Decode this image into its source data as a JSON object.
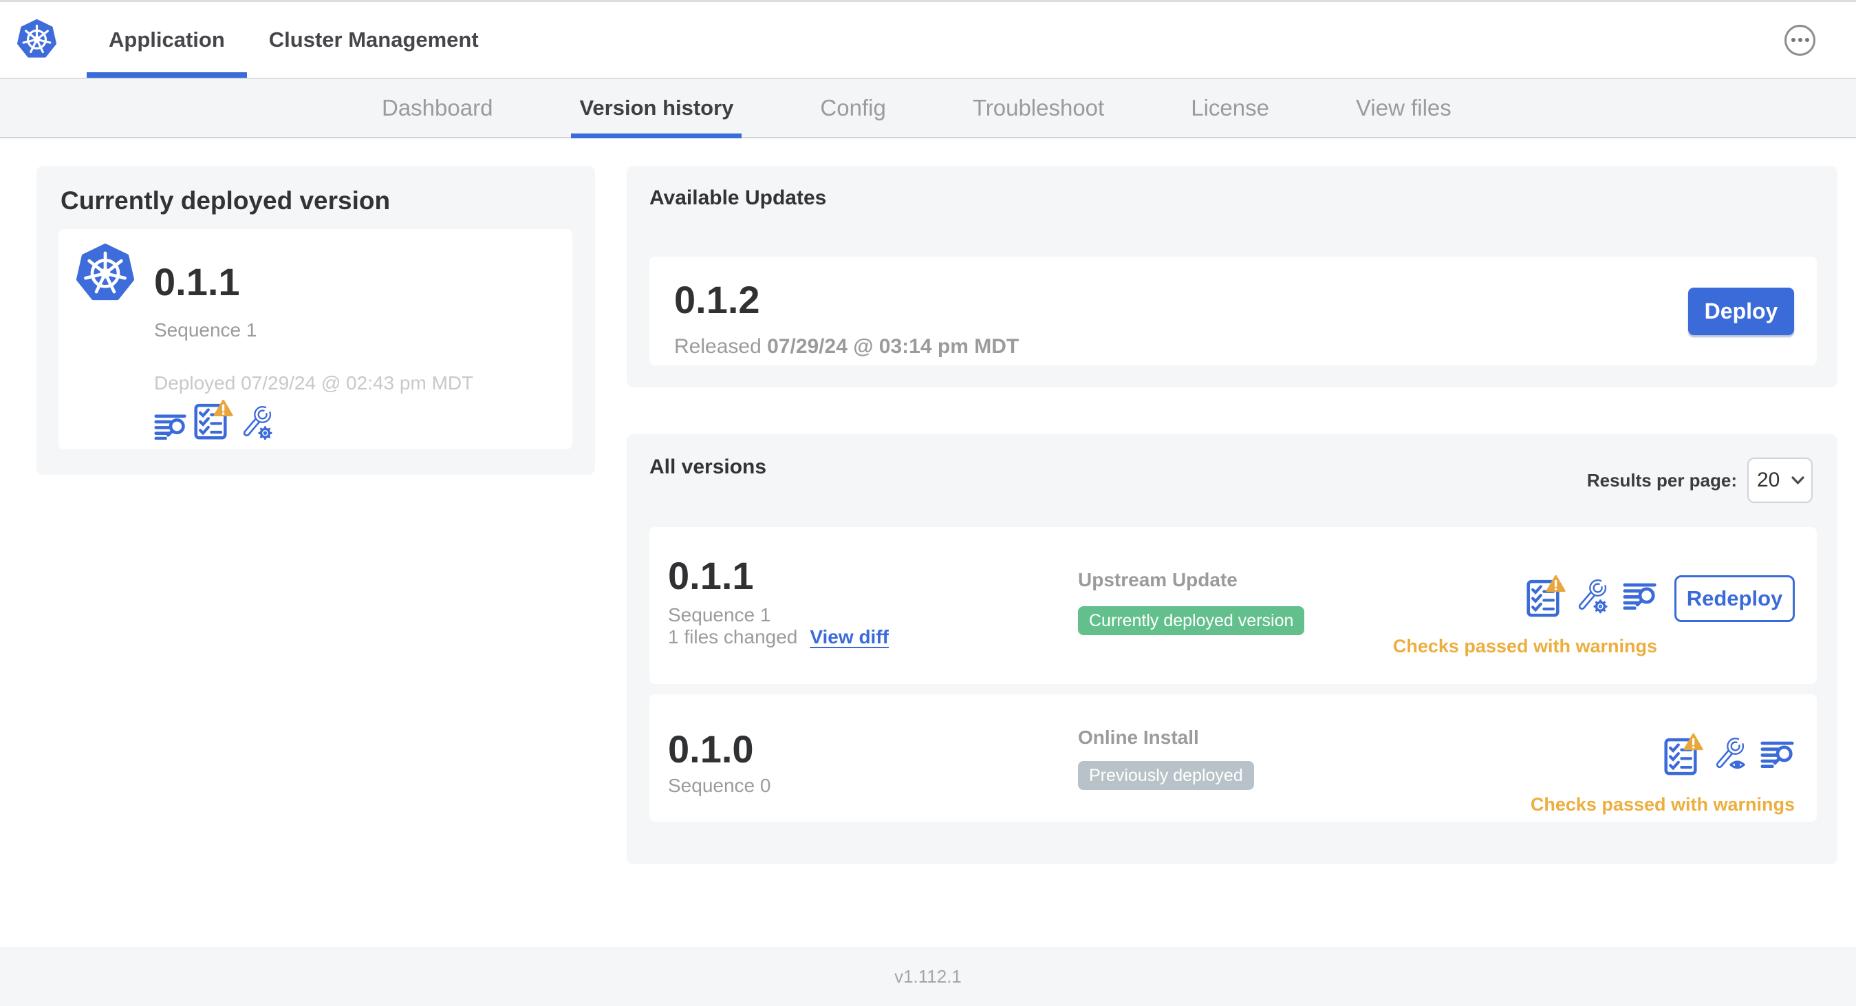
{
  "header": {
    "tabs": [
      {
        "label": "Application",
        "active": true
      },
      {
        "label": "Cluster Management",
        "active": false
      }
    ],
    "menu_icon": "ellipsis-icon"
  },
  "subnav": {
    "tabs": [
      {
        "label": "Dashboard",
        "active": false
      },
      {
        "label": "Version history",
        "active": true
      },
      {
        "label": "Config",
        "active": false
      },
      {
        "label": "Troubleshoot",
        "active": false
      },
      {
        "label": "License",
        "active": false
      },
      {
        "label": "View files",
        "active": false
      }
    ]
  },
  "currently_deployed": {
    "title": "Currently deployed version",
    "version": "0.1.1",
    "sequence": "Sequence 1",
    "deployed_at": "Deployed 07/29/24 @ 02:43 pm MDT",
    "icons": [
      "release-notes-icon",
      "preflight-checks-warning-icon",
      "config-icon"
    ]
  },
  "available_updates": {
    "title": "Available Updates",
    "version": "0.1.2",
    "released_label": "Released",
    "released_at": "07/29/24 @ 03:14 pm MDT",
    "deploy_label": "Deploy"
  },
  "all_versions": {
    "title": "All versions",
    "results_per_page_label": "Results per page:",
    "results_per_page_value": "20",
    "rows": [
      {
        "version": "0.1.1",
        "sequence": "Sequence 1",
        "files_changed": "1 files changed",
        "view_diff_label": "View diff",
        "source": "Upstream Update",
        "status_label": "Currently deployed version",
        "status_type": "deployed",
        "checks_status": "Checks passed with warnings",
        "action_label": "Redeploy",
        "icons": [
          "preflight-checks-warning-icon",
          "config-gear-icon",
          "diff-icon"
        ]
      },
      {
        "version": "0.1.0",
        "sequence": "Sequence 0",
        "source": "Online Install",
        "status_label": "Previously deployed",
        "status_type": "previous",
        "checks_status": "Checks passed with warnings",
        "icons": [
          "preflight-checks-warning-icon",
          "config-view-icon",
          "diff-icon"
        ]
      }
    ]
  },
  "footer": {
    "version": "v1.112.1"
  },
  "colors": {
    "accent_blue": "#3b6bd9",
    "warning_amber": "#e9a63c",
    "badge_green": "#63c08d",
    "badge_gray": "#b7c3c8",
    "panel_gray": "#f5f6f8"
  }
}
